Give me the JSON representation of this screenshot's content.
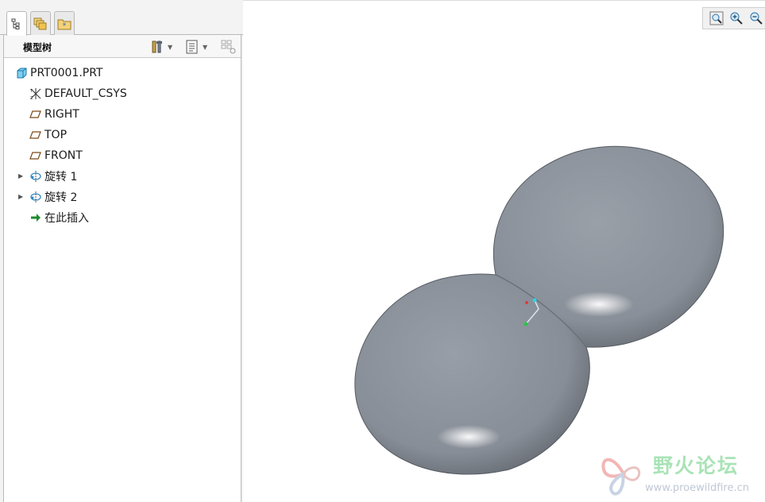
{
  "tabs": [
    {
      "name": "model-tree",
      "icon": "tree-icon"
    },
    {
      "name": "layers",
      "icon": "layers-icon"
    },
    {
      "name": "favorites",
      "icon": "folder-star-icon"
    }
  ],
  "tree_header": {
    "title": "模型树",
    "tools": [
      "settings-tools-icon",
      "show-list-icon",
      "filter-icon"
    ]
  },
  "tree": {
    "items": [
      {
        "label": "PRT0001.PRT",
        "icon": "part-icon",
        "expandable": false
      },
      {
        "label": "DEFAULT_CSYS",
        "icon": "csys-icon",
        "expandable": false
      },
      {
        "label": "RIGHT",
        "icon": "datum-plane-icon",
        "expandable": false
      },
      {
        "label": "TOP",
        "icon": "datum-plane-icon",
        "expandable": false
      },
      {
        "label": "FRONT",
        "icon": "datum-plane-icon",
        "expandable": false
      },
      {
        "label": "旋转 1",
        "icon": "revolve-icon",
        "expandable": true
      },
      {
        "label": "旋转 2",
        "icon": "revolve-icon",
        "expandable": true
      },
      {
        "label": "在此插入",
        "icon": "insert-here-arrow-icon",
        "expandable": false
      }
    ]
  },
  "view_toolbar": [
    "zoom-fit-icon",
    "zoom-in-icon",
    "zoom-out-icon"
  ],
  "watermark": {
    "title": "野火论坛",
    "url": "www.proewildfire.cn"
  },
  "colors": {
    "model_body": "#8f949c",
    "insert_arrow": "#1e8a2e",
    "plane_icon": "#8a5a1e",
    "part_icon": "#3aa7d8"
  }
}
